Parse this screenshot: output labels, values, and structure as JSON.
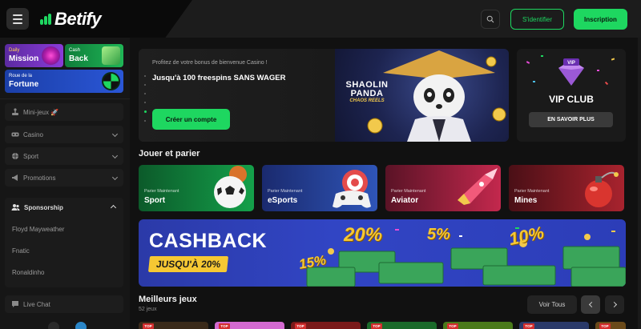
{
  "header": {
    "logo_text": "Betify",
    "login_label": "S'identifier",
    "signup_label": "Inscription"
  },
  "sidebar": {
    "promos": [
      {
        "line1": "Daily",
        "line2": "Mission"
      },
      {
        "line1": "Cash",
        "line2": "Back"
      },
      {
        "line1": "Roue de la",
        "line2": "Fortune"
      }
    ],
    "items": [
      {
        "label": "Mini-jeux 🚀"
      },
      {
        "label": "Casino"
      },
      {
        "label": "Sport"
      },
      {
        "label": "Promotions"
      }
    ],
    "sponsorship": {
      "title": "Sponsorship",
      "items": [
        "Floyd Mayweather",
        "Fnatic",
        "Ronaldinho"
      ]
    },
    "live_chat": "Live Chat"
  },
  "hero": {
    "subtitle": "Profitez de votre bonus de bienvenue Casino !",
    "title": "Jusqu'à 100 freespins SANS WAGER",
    "cta": "Créer un compte",
    "game_logo": {
      "line1": "SHAOLIN",
      "line2": "PANDA",
      "line3": "CHAOS REELS"
    }
  },
  "vip": {
    "badge": "VIP",
    "title": "VIP CLUB",
    "button": "EN SAVOIR PLUS"
  },
  "play_section": {
    "title": "Jouer et parier",
    "categories": [
      {
        "small": "Parier Maintenant",
        "big": "Sport"
      },
      {
        "small": "Parier Maintenant",
        "big": "eSports"
      },
      {
        "small": "Parier Maintenant",
        "big": "Aviator"
      },
      {
        "small": "Parier Maintenant",
        "big": "Mines"
      }
    ]
  },
  "cashback": {
    "title": "CASHBACK",
    "badge": "JUSQU'À 20%",
    "percents": [
      "20%",
      "5%",
      "10%",
      "15%"
    ]
  },
  "best_games": {
    "title": "Meilleurs jeux",
    "count": "52 jeux",
    "see_all": "Voir Tous",
    "tag": "TOP"
  },
  "colors": {
    "accent": "#1ed760",
    "background": "#111111"
  }
}
